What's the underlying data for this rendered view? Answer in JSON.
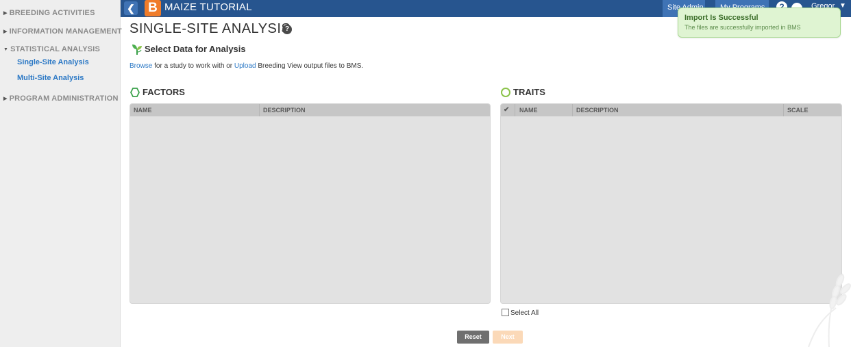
{
  "sidebar": {
    "sections": [
      {
        "label": "BREEDING ACTIVITIES",
        "expanded": false
      },
      {
        "label": "INFORMATION MANAGEMENT",
        "expanded": false
      },
      {
        "label": "STATISTICAL ANALYSIS",
        "expanded": true
      },
      {
        "label": "PROGRAM ADMINISTRATION",
        "expanded": false
      }
    ],
    "sub_items": [
      {
        "label": "Single-Site Analysis"
      },
      {
        "label": "Multi-Site Analysis"
      }
    ]
  },
  "topbar": {
    "logo_letter": "B",
    "program_title": "MAIZE TUTORIAL",
    "site_admin_label": "Site Admin",
    "my_programs_label": "My Programs",
    "help_label": "?",
    "user_name": "Gregor"
  },
  "toast": {
    "title": "Import Is Successful",
    "message": "The files are successfully imported in BMS"
  },
  "main": {
    "title": "SINGLE-SITE ANALYSIS",
    "help_glyph": "?",
    "select_title": "Select Data for Analysis",
    "browse_link": "Browse",
    "browse_text": "for a study to work with",
    "or_text": "or",
    "upload_link": "Upload",
    "upload_text": "Breeding View output files to BMS."
  },
  "factors": {
    "heading": "FACTORS",
    "columns": [
      "NAME",
      "DESCRIPTION"
    ]
  },
  "traits": {
    "heading": "TRAITS",
    "check_glyph": "✔",
    "columns": [
      "NAME",
      "DESCRIPTION",
      "SCALE"
    ],
    "select_all_label": "Select All"
  },
  "buttons": {
    "reset": "Reset",
    "next": "Next"
  },
  "colors": {
    "topbar": "#27558f",
    "accent_link": "#2b78c5",
    "logo": "#f07c2a",
    "toast_bg": "#dff4d2",
    "factors_icon": "#3aa14a",
    "traits_icon": "#8bc34a",
    "next_disabled": "#fbd9b8"
  },
  "icons": {
    "back": "chevron-left-icon",
    "help": "question-circle-icon",
    "user": "user-icon",
    "caret": "caret-down-icon",
    "select_data": "plant-icon",
    "factors": "hexagon-icon",
    "traits": "circle-icon"
  }
}
